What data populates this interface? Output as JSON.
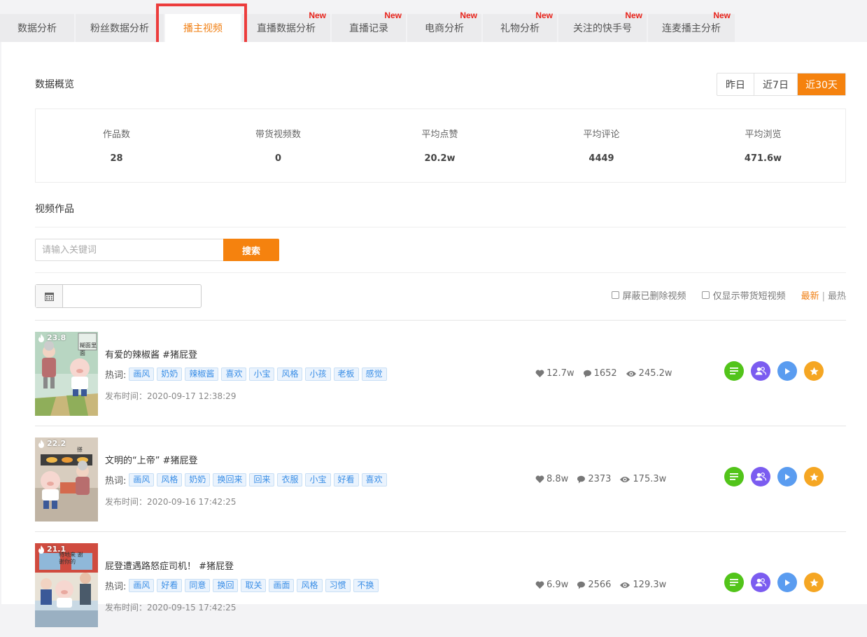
{
  "tabs": [
    {
      "label": "数据分析",
      "new": ""
    },
    {
      "label": "粉丝数据分析",
      "new": ""
    },
    {
      "label": "播主视频",
      "new": ""
    },
    {
      "label": "直播数据分析",
      "new": "New"
    },
    {
      "label": "直播记录",
      "new": "New"
    },
    {
      "label": "电商分析",
      "new": "New"
    },
    {
      "label": "礼物分析",
      "new": "New"
    },
    {
      "label": "关注的快手号",
      "new": "New"
    },
    {
      "label": "连麦播主分析",
      "new": "New"
    }
  ],
  "overview": {
    "title": "数据概览",
    "ranges": [
      "昨日",
      "近7日",
      "近30天"
    ],
    "stats": [
      {
        "label": "作品数",
        "value": "28"
      },
      {
        "label": "带货视频数",
        "value": "0"
      },
      {
        "label": "平均点赞",
        "value": "20.2w"
      },
      {
        "label": "平均评论",
        "value": "4449"
      },
      {
        "label": "平均浏览",
        "value": "471.6w"
      }
    ]
  },
  "videos_section": {
    "title": "视频作品",
    "search_placeholder": "请输入关键词",
    "search_value": "",
    "search_button": "搜索",
    "date_value": "",
    "filter_deleted": "屏蔽已删除视频",
    "filter_goods": "仅显示带货短视频",
    "sort_new": "最新",
    "sort_sep": "|",
    "sort_hot": "最热"
  },
  "colors": {
    "accent": "#f5820e",
    "new_badge": "#e8231b",
    "green": "#52c41a",
    "purple": "#7b5cf0",
    "blue": "#5a9cf0",
    "orange": "#f5a623"
  },
  "videos": [
    {
      "heat": "23.8",
      "title": "有爱的辣椒酱 #猪屁登",
      "tags_label": "热词:",
      "tags": [
        "画风",
        "奶奶",
        "辣椒酱",
        "喜欢",
        "小宝",
        "风格",
        "小孩",
        "老板",
        "感觉"
      ],
      "time": "发布时间：2020-09-17 12:38:29",
      "likes": "12.7w",
      "comments": "1652",
      "views": "245.2w",
      "thumb_text": "糊面里面"
    },
    {
      "heat": "22.2",
      "title": "文明的“上帝” #猪屁登",
      "tags_label": "热词:",
      "tags": [
        "画风",
        "风格",
        "奶奶",
        "换回来",
        "回来",
        "衣服",
        "小宝",
        "好看",
        "喜欢"
      ],
      "time": "发布时间：2020-09-16 17:42:25",
      "likes": "8.8w",
      "comments": "2373",
      "views": "175.3w",
      "thumb_text": "搽"
    },
    {
      "heat": "21.1",
      "title": "屁登遭遇路怒症司机！ #猪屁登",
      "tags_label": "热词:",
      "tags": [
        "画风",
        "好看",
        "同意",
        "换回",
        "取关",
        "画面",
        "风格",
        "习惯",
        "不换"
      ],
      "time": "发布时间：2020-09-15 17:42:25",
      "likes": "6.9w",
      "comments": "2566",
      "views": "129.3w",
      "thumb_text": "特地来 谢谢你的"
    }
  ]
}
